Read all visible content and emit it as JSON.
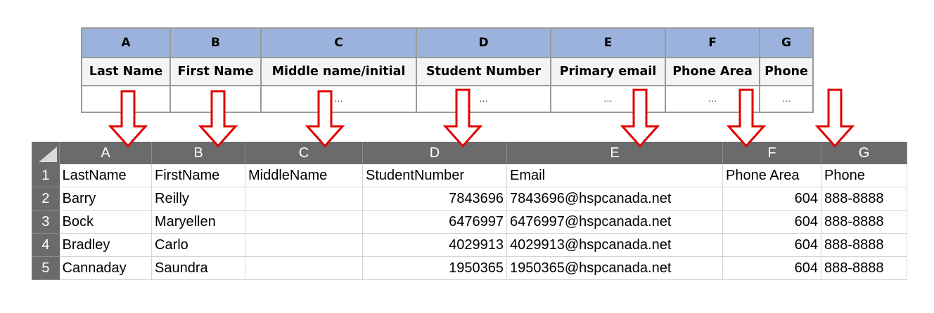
{
  "template": {
    "column_letters": [
      "A",
      "B",
      "C",
      "D",
      "E",
      "F",
      "G"
    ],
    "headers": [
      "Last Name",
      "First Name",
      "Middle name/initial",
      "Student Number",
      "Primary email",
      "Phone Area",
      "Phone"
    ],
    "placeholders": [
      "...",
      "...",
      "...",
      "...",
      "...",
      "...",
      "..."
    ]
  },
  "sheet": {
    "column_letters": [
      "A",
      "B",
      "C",
      "D",
      "E",
      "F",
      "G"
    ],
    "row_numbers": [
      "1",
      "2",
      "3",
      "4",
      "5"
    ],
    "rows": [
      [
        "LastName",
        "FirstName",
        "MiddleName",
        "StudentNumber",
        "Email",
        "Phone Area",
        "Phone"
      ],
      [
        "Barry",
        "Reilly",
        "",
        "7843696",
        "7843696@hspcanada.net",
        "604",
        "888-8888"
      ],
      [
        "Bock",
        "Maryellen",
        "",
        "6476997",
        "6476997@hspcanada.net",
        "604",
        "888-8888"
      ],
      [
        "Bradley",
        "Carlo",
        "",
        "4029913",
        "4029913@hspcanada.net",
        "604",
        "888-8888"
      ],
      [
        "Cannaday",
        "Saundra",
        "",
        "1950365",
        "1950365@hspcanada.net",
        "604",
        "888-8888"
      ]
    ]
  },
  "colors": {
    "template_letter_bg": "#9bb3dc",
    "sheet_header_bg": "#6b6b6b",
    "arrow": "#e00000"
  }
}
